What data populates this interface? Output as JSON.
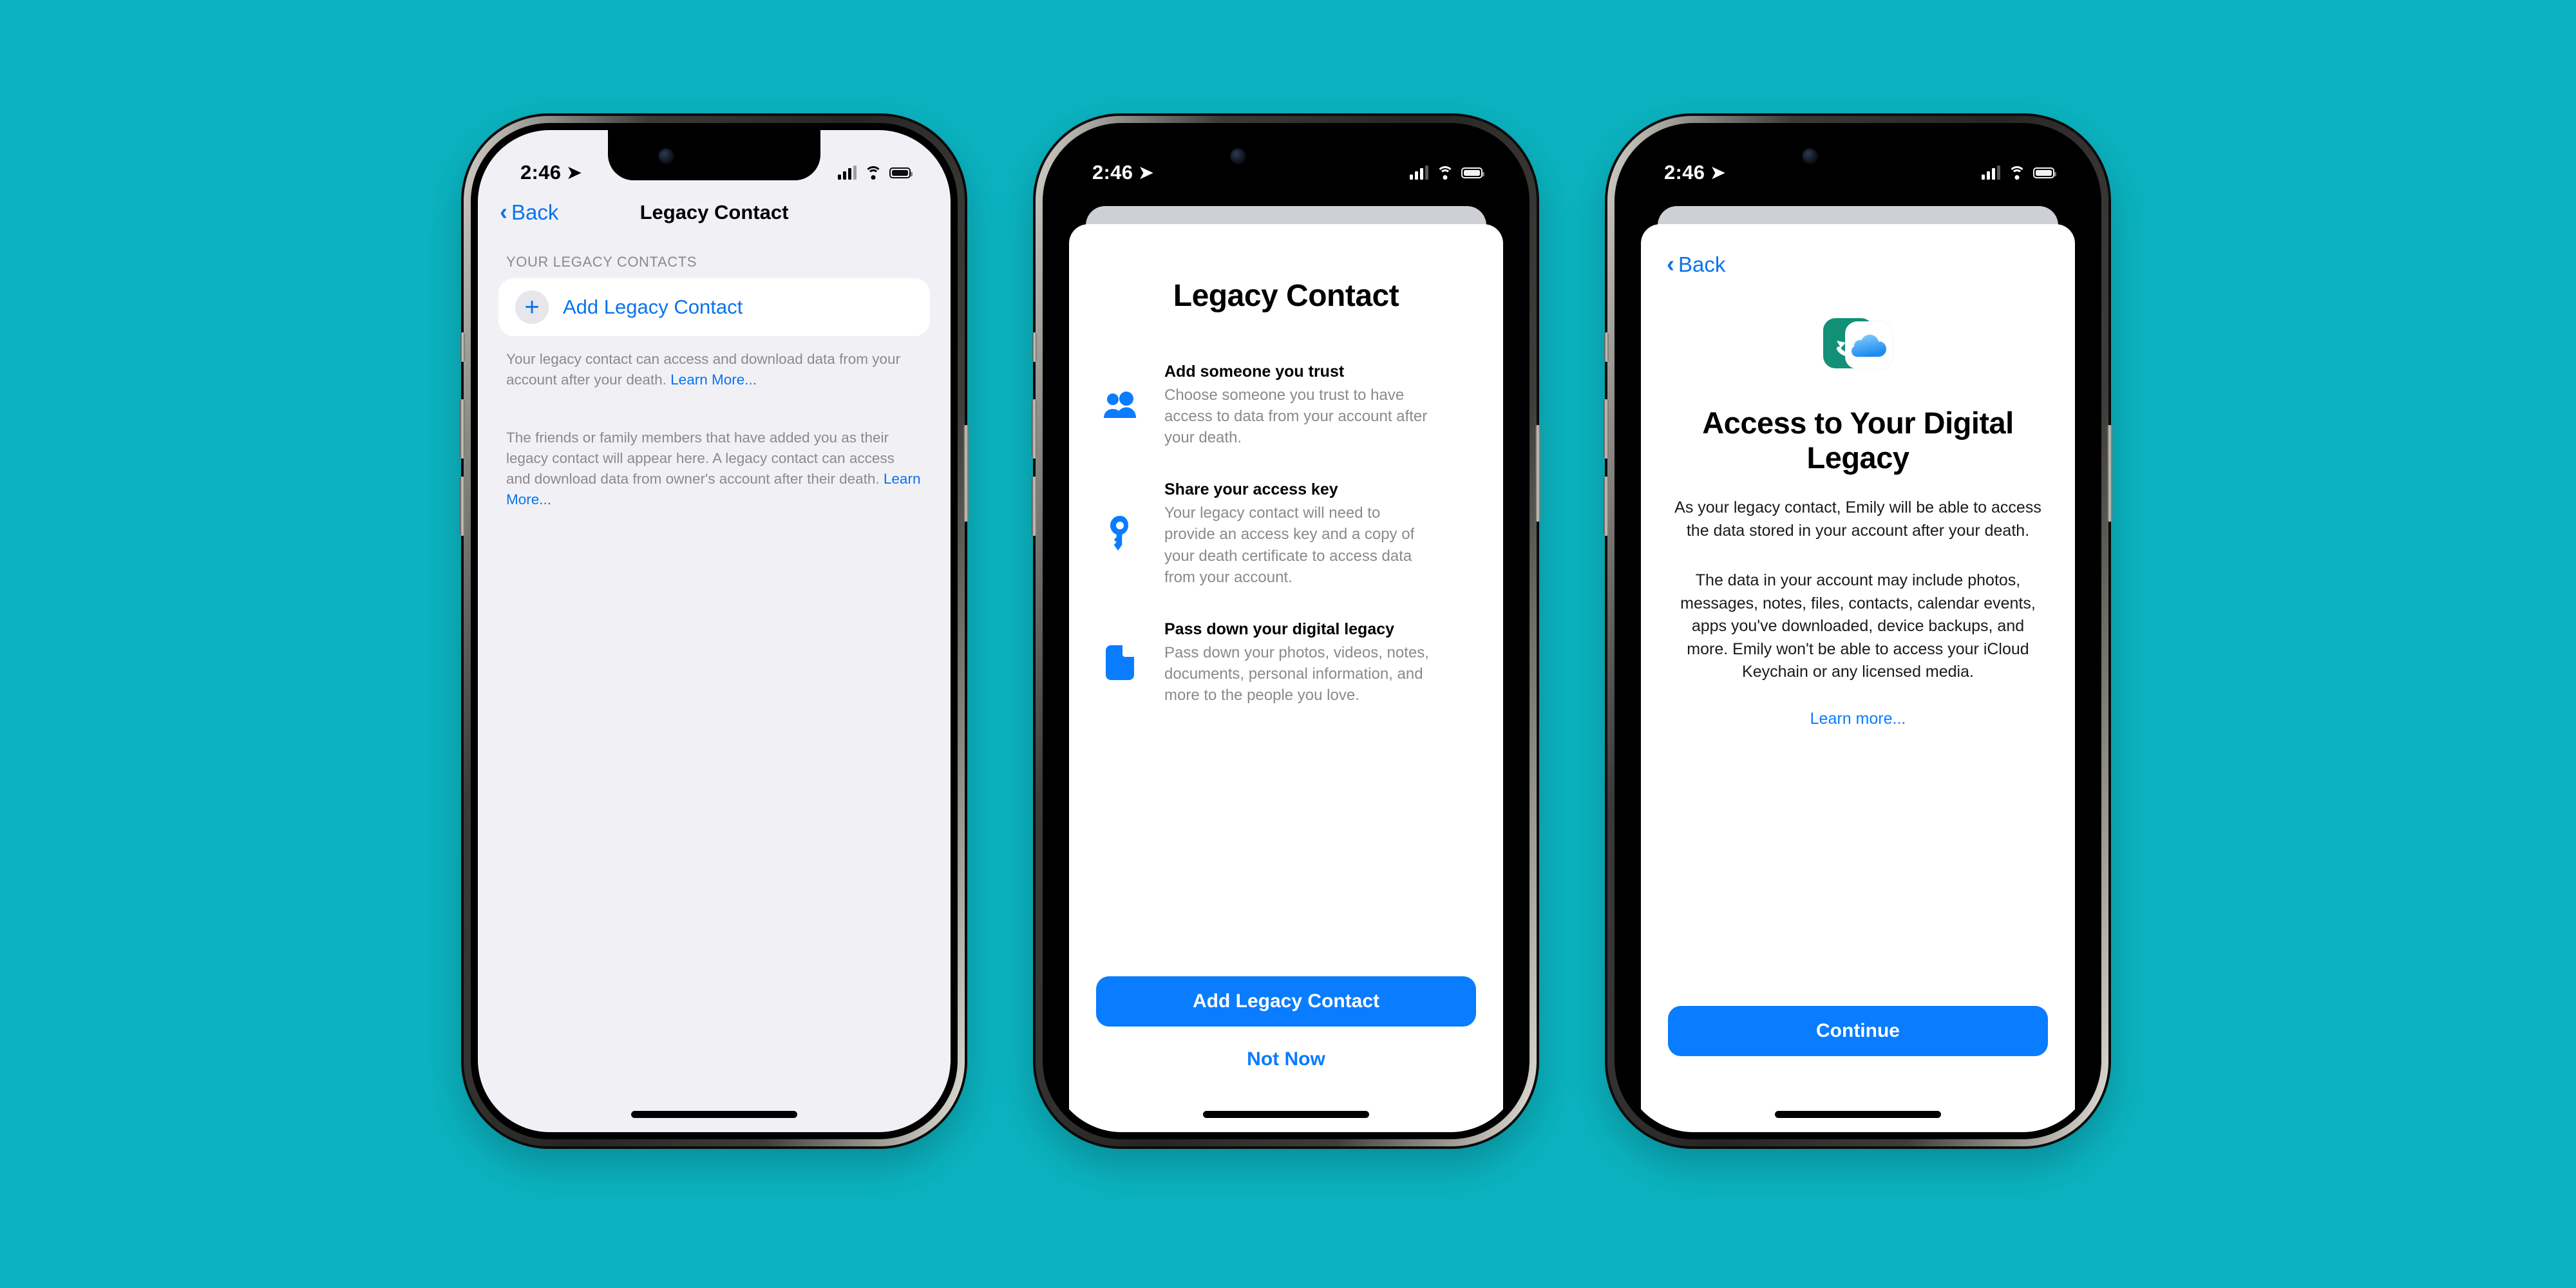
{
  "background_color": "#0bb2bf",
  "accent_color": "#0a7cff",
  "phone1": {
    "status": {
      "time": "2:46",
      "location_arrow": "location-arrow",
      "battery": "full",
      "wifi": "wifi",
      "cellular": "3-of-4-bars"
    },
    "nav": {
      "back_label": "Back",
      "title": "Legacy Contact"
    },
    "section_header": "YOUR LEGACY CONTACTS",
    "add_row": {
      "icon": "plus-icon",
      "label": "Add Legacy Contact"
    },
    "footnote_1": {
      "text": "Your legacy contact can access and download data from your account after your death. ",
      "link": "Learn More..."
    },
    "footnote_2": {
      "text": "The friends or family members that have added you as their legacy contact will appear here. A legacy contact can access and download data from owner's account after their death. ",
      "link": "Learn More..."
    }
  },
  "phone2": {
    "status": {
      "time": "2:46"
    },
    "title": "Legacy Contact",
    "features": [
      {
        "icon": "people-icon",
        "heading": "Add someone you trust",
        "body": "Choose someone you trust to have access to data from your account after your death."
      },
      {
        "icon": "key-icon",
        "heading": "Share your access key",
        "body": "Your legacy contact will need to provide an access key and a copy of your death certificate to access data from your account."
      },
      {
        "icon": "document-icon",
        "heading": "Pass down your digital legacy",
        "body": "Pass down your photos, videos, notes, documents, personal information, and more to the people you love."
      }
    ],
    "primary_button": "Add Legacy Contact",
    "secondary_button": "Not Now"
  },
  "phone3": {
    "status": {
      "time": "2:46"
    },
    "back_label": "Back",
    "icon": "icloud-restore-icon",
    "icon_colors": {
      "green": "#129178",
      "cloud_blue": "#3aa0f5"
    },
    "title": "Access to Your Digital Legacy",
    "paragraph_1": "As your legacy contact, Emily will be able to access the data stored in your account after your death.",
    "paragraph_2": "The data in your account may include photos, messages, notes, files, contacts, calendar events, apps you've downloaded, device backups, and more. Emily won't be able to access your iCloud Keychain or any licensed media.",
    "learn_more": "Learn more...",
    "primary_button": "Continue"
  }
}
